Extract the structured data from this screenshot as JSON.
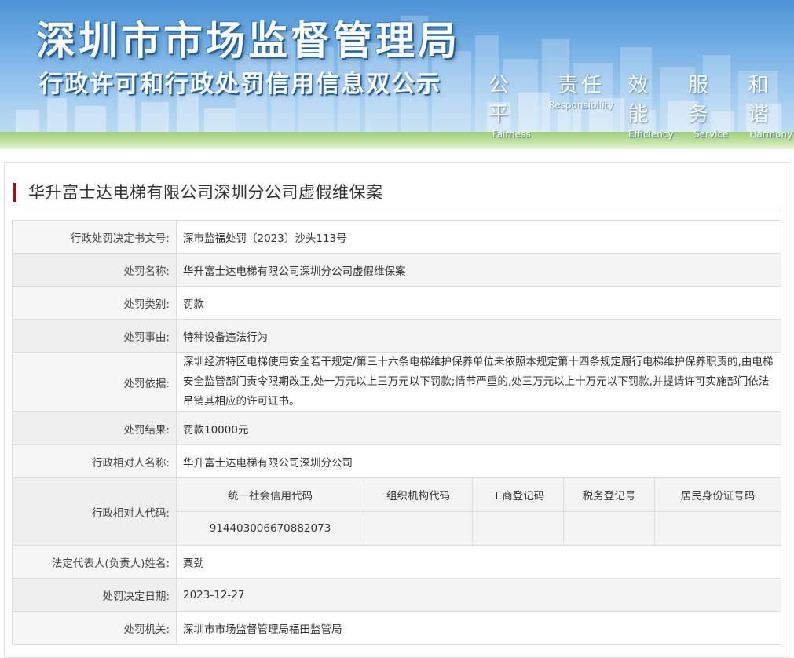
{
  "banner": {
    "title": "深圳市市场监督管理局",
    "subtitle": "行政许可和行政处罚信用信息双公示",
    "slogans": [
      {
        "cn": "公平",
        "en": "Fairness"
      },
      {
        "cn": "责任",
        "en": "Responsibility"
      },
      {
        "cn": "效能",
        "en": "Efficiency"
      },
      {
        "cn": "服务",
        "en": "Service"
      },
      {
        "cn": "和谐",
        "en": "Harmony"
      }
    ]
  },
  "case": {
    "title": "华升富士达电梯有限公司深圳分公司虚假维保案"
  },
  "rows": {
    "decision_no": {
      "label": "行政处罚决定书文号:",
      "value": "深市监福处罚〔2023〕沙头113号"
    },
    "name": {
      "label": "处罚名称:",
      "value": "华升富士达电梯有限公司深圳分公司虚假维保案"
    },
    "category": {
      "label": "处罚类别:",
      "value": "罚款"
    },
    "reason": {
      "label": "处罚事由:",
      "value": "特种设备违法行为"
    },
    "basis": {
      "label": "处罚依据:",
      "value": "深圳经济特区电梯使用安全若干规定/第三十六条电梯维护保养单位未依照本规定第十四条规定履行电梯维护保养职责的,由电梯安全监管部门责令限期改正,处一万元以上三万元以下罚款;情节严重的,处三万元以上十万元以下罚款,并提请许可实施部门依法吊销其相应的许可证书。"
    },
    "result": {
      "label": "处罚结果:",
      "value": "罚款10000元"
    },
    "party_name": {
      "label": "行政相对人名称:",
      "value": "华升富士达电梯有限公司深圳分公司"
    },
    "party_code": {
      "label": "行政相对人代码:",
      "headers": [
        "统一社会信用代码",
        "组织机构代码",
        "工商登记码",
        "税务登记号",
        "居民身份证号码"
      ],
      "values": [
        "914403006670882073",
        "",
        "",
        "",
        ""
      ]
    },
    "legal_rep": {
      "label": "法定代表人(负责人)姓名:",
      "value": "粟劲"
    },
    "decision_date": {
      "label": "处罚决定日期:",
      "value": "2023-12-27"
    },
    "authority": {
      "label": "处罚机关:",
      "value": "深圳市市场监督管理局福田监管局"
    }
  },
  "colors": {
    "title_bar": "#8b1a1a",
    "banner_sky": "#78b2e6"
  }
}
